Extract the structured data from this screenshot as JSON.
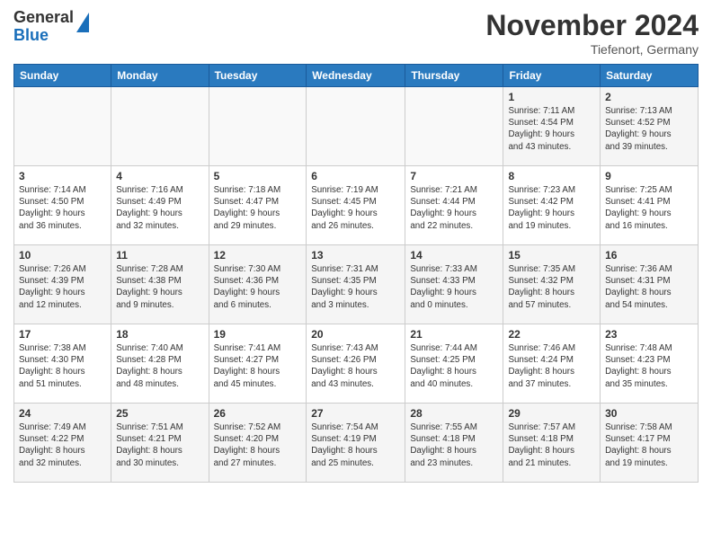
{
  "header": {
    "logo_line1": "General",
    "logo_line2": "Blue",
    "month": "November 2024",
    "location": "Tiefenort, Germany"
  },
  "weekdays": [
    "Sunday",
    "Monday",
    "Tuesday",
    "Wednesday",
    "Thursday",
    "Friday",
    "Saturday"
  ],
  "weeks": [
    [
      {
        "day": "",
        "detail": ""
      },
      {
        "day": "",
        "detail": ""
      },
      {
        "day": "",
        "detail": ""
      },
      {
        "day": "",
        "detail": ""
      },
      {
        "day": "",
        "detail": ""
      },
      {
        "day": "1",
        "detail": "Sunrise: 7:11 AM\nSunset: 4:54 PM\nDaylight: 9 hours\nand 43 minutes."
      },
      {
        "day": "2",
        "detail": "Sunrise: 7:13 AM\nSunset: 4:52 PM\nDaylight: 9 hours\nand 39 minutes."
      }
    ],
    [
      {
        "day": "3",
        "detail": "Sunrise: 7:14 AM\nSunset: 4:50 PM\nDaylight: 9 hours\nand 36 minutes."
      },
      {
        "day": "4",
        "detail": "Sunrise: 7:16 AM\nSunset: 4:49 PM\nDaylight: 9 hours\nand 32 minutes."
      },
      {
        "day": "5",
        "detail": "Sunrise: 7:18 AM\nSunset: 4:47 PM\nDaylight: 9 hours\nand 29 minutes."
      },
      {
        "day": "6",
        "detail": "Sunrise: 7:19 AM\nSunset: 4:45 PM\nDaylight: 9 hours\nand 26 minutes."
      },
      {
        "day": "7",
        "detail": "Sunrise: 7:21 AM\nSunset: 4:44 PM\nDaylight: 9 hours\nand 22 minutes."
      },
      {
        "day": "8",
        "detail": "Sunrise: 7:23 AM\nSunset: 4:42 PM\nDaylight: 9 hours\nand 19 minutes."
      },
      {
        "day": "9",
        "detail": "Sunrise: 7:25 AM\nSunset: 4:41 PM\nDaylight: 9 hours\nand 16 minutes."
      }
    ],
    [
      {
        "day": "10",
        "detail": "Sunrise: 7:26 AM\nSunset: 4:39 PM\nDaylight: 9 hours\nand 12 minutes."
      },
      {
        "day": "11",
        "detail": "Sunrise: 7:28 AM\nSunset: 4:38 PM\nDaylight: 9 hours\nand 9 minutes."
      },
      {
        "day": "12",
        "detail": "Sunrise: 7:30 AM\nSunset: 4:36 PM\nDaylight: 9 hours\nand 6 minutes."
      },
      {
        "day": "13",
        "detail": "Sunrise: 7:31 AM\nSunset: 4:35 PM\nDaylight: 9 hours\nand 3 minutes."
      },
      {
        "day": "14",
        "detail": "Sunrise: 7:33 AM\nSunset: 4:33 PM\nDaylight: 9 hours\nand 0 minutes."
      },
      {
        "day": "15",
        "detail": "Sunrise: 7:35 AM\nSunset: 4:32 PM\nDaylight: 8 hours\nand 57 minutes."
      },
      {
        "day": "16",
        "detail": "Sunrise: 7:36 AM\nSunset: 4:31 PM\nDaylight: 8 hours\nand 54 minutes."
      }
    ],
    [
      {
        "day": "17",
        "detail": "Sunrise: 7:38 AM\nSunset: 4:30 PM\nDaylight: 8 hours\nand 51 minutes."
      },
      {
        "day": "18",
        "detail": "Sunrise: 7:40 AM\nSunset: 4:28 PM\nDaylight: 8 hours\nand 48 minutes."
      },
      {
        "day": "19",
        "detail": "Sunrise: 7:41 AM\nSunset: 4:27 PM\nDaylight: 8 hours\nand 45 minutes."
      },
      {
        "day": "20",
        "detail": "Sunrise: 7:43 AM\nSunset: 4:26 PM\nDaylight: 8 hours\nand 43 minutes."
      },
      {
        "day": "21",
        "detail": "Sunrise: 7:44 AM\nSunset: 4:25 PM\nDaylight: 8 hours\nand 40 minutes."
      },
      {
        "day": "22",
        "detail": "Sunrise: 7:46 AM\nSunset: 4:24 PM\nDaylight: 8 hours\nand 37 minutes."
      },
      {
        "day": "23",
        "detail": "Sunrise: 7:48 AM\nSunset: 4:23 PM\nDaylight: 8 hours\nand 35 minutes."
      }
    ],
    [
      {
        "day": "24",
        "detail": "Sunrise: 7:49 AM\nSunset: 4:22 PM\nDaylight: 8 hours\nand 32 minutes."
      },
      {
        "day": "25",
        "detail": "Sunrise: 7:51 AM\nSunset: 4:21 PM\nDaylight: 8 hours\nand 30 minutes."
      },
      {
        "day": "26",
        "detail": "Sunrise: 7:52 AM\nSunset: 4:20 PM\nDaylight: 8 hours\nand 27 minutes."
      },
      {
        "day": "27",
        "detail": "Sunrise: 7:54 AM\nSunset: 4:19 PM\nDaylight: 8 hours\nand 25 minutes."
      },
      {
        "day": "28",
        "detail": "Sunrise: 7:55 AM\nSunset: 4:18 PM\nDaylight: 8 hours\nand 23 minutes."
      },
      {
        "day": "29",
        "detail": "Sunrise: 7:57 AM\nSunset: 4:18 PM\nDaylight: 8 hours\nand 21 minutes."
      },
      {
        "day": "30",
        "detail": "Sunrise: 7:58 AM\nSunset: 4:17 PM\nDaylight: 8 hours\nand 19 minutes."
      }
    ]
  ]
}
